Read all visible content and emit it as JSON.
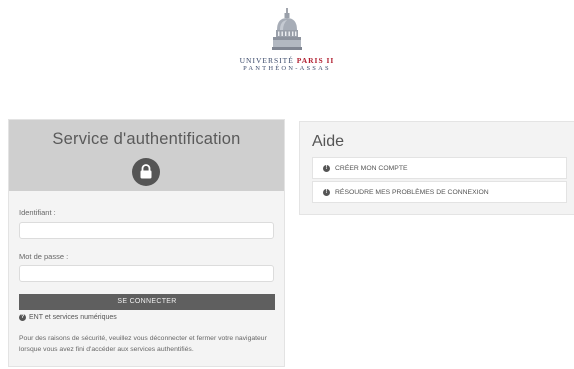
{
  "logo": {
    "line1_part1": "UNIVERSITÉ ",
    "line1_part2": "PARIS II",
    "line2": "PANTHÉON-ASSAS"
  },
  "login": {
    "title": "Service d'authentification",
    "username_label": "Identifiant :",
    "username_value": "",
    "password_label": "Mot de passe :",
    "password_value": "",
    "submit_label": "SE CONNECTER",
    "ent_link": "ENT et services numériques",
    "security_note": "Pour des raisons de sécurité, veuillez vous déconnecter et fermer votre navigateur lorsque vous avez fini d'accéder aux services authentifiés."
  },
  "help": {
    "title": "Aide",
    "items": [
      {
        "label": "CRÉER MON COMPTE",
        "icon": "info-icon"
      },
      {
        "label": "RÉSOUDRE MES PROBLÈMES DE CONNEXION",
        "icon": "info-icon"
      }
    ]
  },
  "colors": {
    "header_gray": "#cfcfcf",
    "button_gray": "#5f5f5f",
    "brand_red": "#b01e2f",
    "brand_blue": "#3b4a6b"
  }
}
